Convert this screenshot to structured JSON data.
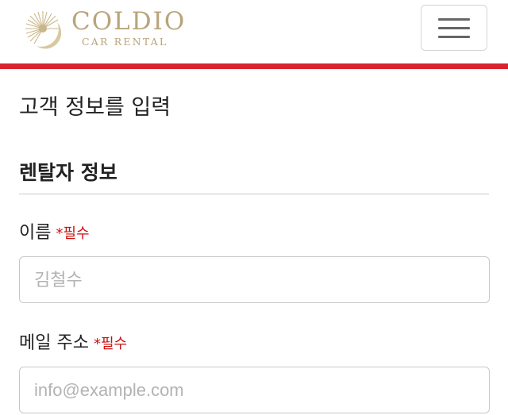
{
  "header": {
    "logo_name": "COLDIO",
    "logo_sub": "CAR RENTAL",
    "logo_icon": "sunburst-logo-icon",
    "menu_icon": "hamburger-menu-icon"
  },
  "colors": {
    "accent": "#d8242f",
    "logo_gold": "#b9a47a",
    "required": "#cc1111"
  },
  "page": {
    "title": "고객 정보를 입력"
  },
  "section": {
    "title": "렌탈자 정보"
  },
  "form": {
    "name": {
      "label": "이름",
      "required_label": "*필수",
      "placeholder": "김철수",
      "value": ""
    },
    "email": {
      "label": "메일 주소",
      "required_label": "*필수",
      "placeholder": "info@example.com",
      "value": ""
    }
  }
}
